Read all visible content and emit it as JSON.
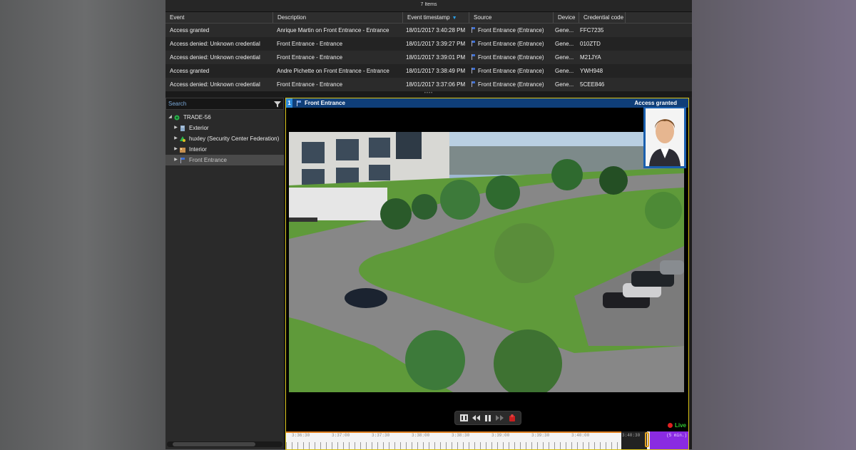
{
  "items_count": "7 Items",
  "table": {
    "columns": [
      "Event",
      "Description",
      "Event timestamp",
      "Source",
      "Device",
      "Credential code"
    ],
    "sorted_column": "Event timestamp",
    "rows": [
      {
        "event": "Access granted",
        "description": "Anrique Martin on Front Entrance - Entrance",
        "timestamp": "18/01/2017 3:40:28 PM",
        "source": "Front Entrance (Entrance)",
        "device": "Gene...",
        "credential": "FFC7235"
      },
      {
        "event": "Access denied: Unknown credential",
        "description": "Front Entrance - Entrance",
        "timestamp": "18/01/2017 3:39:27 PM",
        "source": "Front Entrance (Entrance)",
        "device": "Gene...",
        "credential": "010ZTD"
      },
      {
        "event": "Access denied: Unknown credential",
        "description": "Front Entrance - Entrance",
        "timestamp": "18/01/2017 3:39:01 PM",
        "source": "Front Entrance (Entrance)",
        "device": "Gene...",
        "credential": "M21JYA"
      },
      {
        "event": "Access granted",
        "description": "Andre Pichette on Front Entrance - Entrance",
        "timestamp": "18/01/2017 3:38:49 PM",
        "source": "Front Entrance (Entrance)",
        "device": "Gene...",
        "credential": "YWH948"
      },
      {
        "event": "Access denied: Unknown credential",
        "description": "Front Entrance - Entrance",
        "timestamp": "18/01/2017 3:37:06 PM",
        "source": "Front Entrance (Entrance)",
        "device": "Gene...",
        "credential": "5CEE846"
      }
    ]
  },
  "search": {
    "placeholder": "Search"
  },
  "tree": {
    "root": "TRADE-56",
    "items": [
      "Exterior",
      "huxley (Security Center Federation)",
      "Interior",
      "Front Entrance"
    ],
    "selected": "Front Entrance"
  },
  "tile": {
    "number": "1",
    "title": "Front Entrance",
    "event_label": "Access granted",
    "live_label": "Live"
  },
  "timeline": {
    "labels": [
      "3:36:30",
      "3:37:00",
      "3:37:30",
      "3:38:00",
      "3:38:30",
      "3:39:00",
      "3:39:30",
      "3:40:00",
      "3:40:30"
    ],
    "range_label": "(5 min.)"
  },
  "colors": {
    "accent": "#2a9fe8",
    "tile_header": "#0f3e78",
    "selected_border": "#d8c214",
    "live": "#32c832",
    "record": "#e02020",
    "timeline_future": "#8a2be2"
  }
}
